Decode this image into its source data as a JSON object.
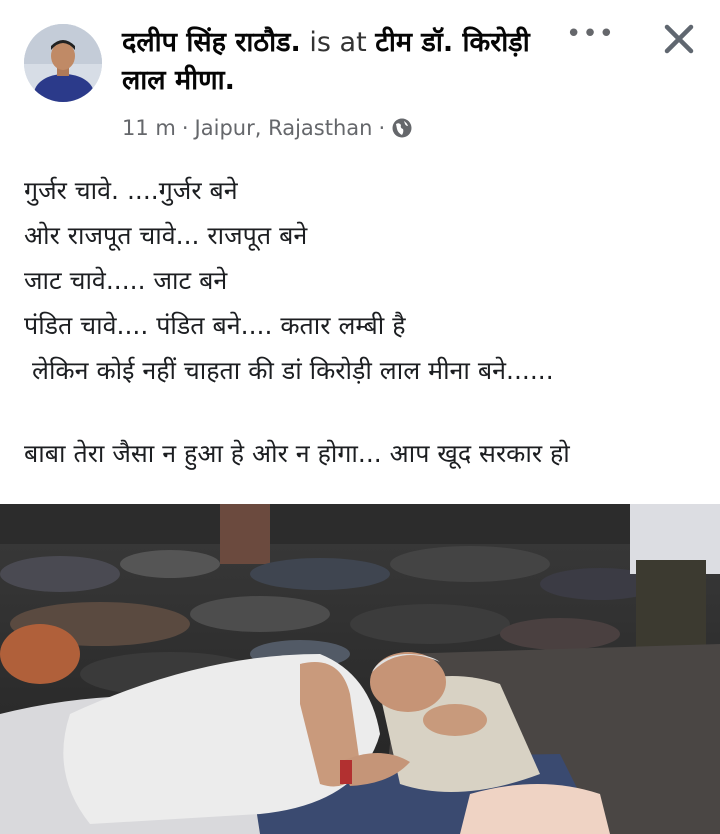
{
  "post": {
    "author": "दलीप सिंह राठौड.",
    "is_at": "is at",
    "page": "टीम डॉ. किरोड़ी लाल मीणा.",
    "time": "11 m",
    "location": "Jaipur, Rajasthan",
    "separator": "·",
    "lines": [
      "गुर्जर चावे. ....गुर्जर बने",
      "ओर राजपूत चावे... राजपूत बने",
      "जाट चावे..... जाट बने",
      "पंडित चावे.... पंडित बने.... कतार लम्बी है",
      "लेकिन कोई नहीं चाहता की डां किरोड़ी लाल मीना बने......",
      "बाबा तेरा जैसा न हुआ हे ओर न होगा... आप खूद सरकार हो"
    ]
  },
  "icons": {
    "more": "more-icon",
    "close": "close-icon",
    "globe": "globe-icon"
  }
}
